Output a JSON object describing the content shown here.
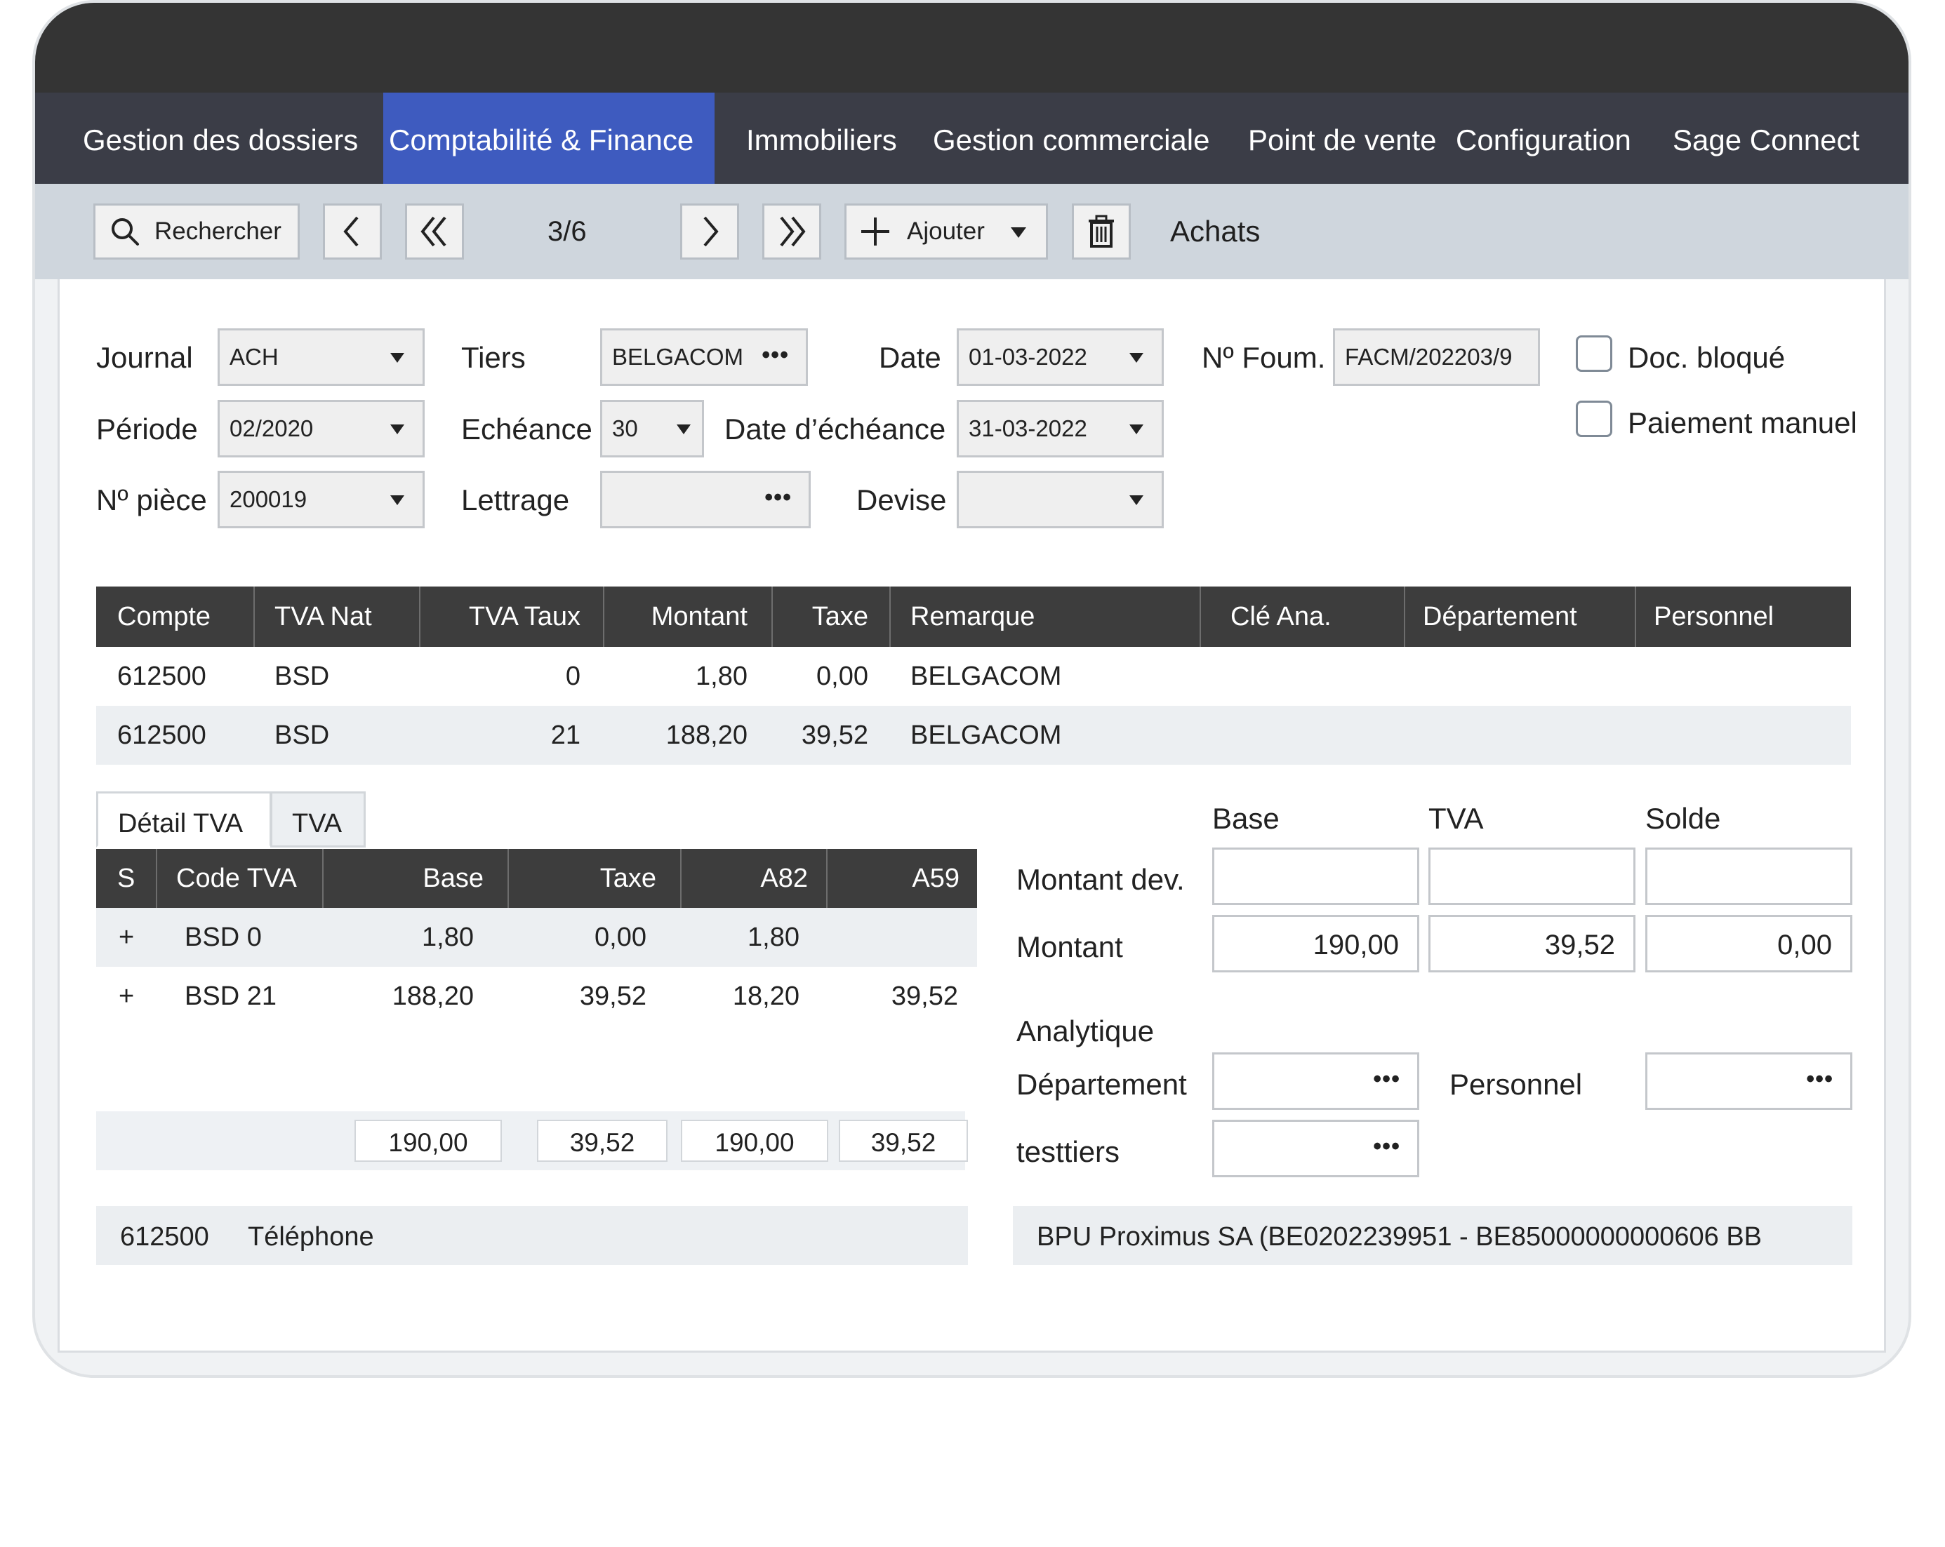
{
  "menu": {
    "items": [
      {
        "label": "Gestion des dossiers"
      },
      {
        "label": "Comptabilité & Finance",
        "active": true
      },
      {
        "label": "Immobiliers"
      },
      {
        "label": "Gestion commerciale"
      },
      {
        "label": "Point de vente"
      },
      {
        "label": "Configuration"
      },
      {
        "label": "Sage Connect"
      }
    ]
  },
  "toolbar": {
    "search_label": "Rechercher",
    "pager": "3/6",
    "add_label": "Ajouter",
    "section": "Achats",
    "icons": [
      "search-icon",
      "chevron-left-icon",
      "double-chevron-left-icon",
      "chevron-right-icon",
      "double-chevron-right-icon",
      "plus-icon",
      "caret-down-icon",
      "trash-icon"
    ]
  },
  "form": {
    "journal": {
      "label": "Journal",
      "value": "ACH"
    },
    "periode": {
      "label": "Période",
      "value": "02/2020"
    },
    "piece": {
      "label": "Nº pièce",
      "value": "200019"
    },
    "tiers": {
      "label": "Tiers",
      "value": "BELGACOM"
    },
    "echeance": {
      "label": "Echéance",
      "value": "30"
    },
    "lettrage": {
      "label": "Lettrage",
      "value": ""
    },
    "date": {
      "label": "Date",
      "value": "01-03-2022"
    },
    "date_echeance": {
      "label": "Date d’échéance",
      "value": "31-03-2022"
    },
    "devise": {
      "label": "Devise",
      "value": ""
    },
    "num_fourn": {
      "label": "Nº Foum.",
      "value": "FACM/202203/9"
    },
    "doc_bloque": {
      "label": "Doc. bloqué",
      "checked": false
    },
    "paiement_manuel": {
      "label": "Paiement manuel",
      "checked": false
    }
  },
  "lines": {
    "columns": [
      "Compte",
      "TVA Nat",
      "TVA Taux",
      "Montant",
      "Taxe",
      "Remarque",
      "Clé Ana.",
      "Département",
      "Personnel"
    ],
    "rows": [
      [
        "612500",
        "BSD",
        "0",
        "1,80",
        "0,00",
        "BELGACOM",
        "",
        "",
        ""
      ],
      [
        "612500",
        "BSD",
        "21",
        "188,20",
        "39,52",
        "BELGACOM",
        "",
        "",
        ""
      ]
    ]
  },
  "vat": {
    "tabs": [
      "Détail TVA",
      "TVA"
    ],
    "columns": [
      "S",
      "Code TVA",
      "Base",
      "Taxe",
      "A82",
      "A59"
    ],
    "rows": [
      [
        "+",
        "BSD 0",
        "1,80",
        "0,00",
        "1,80",
        ""
      ],
      [
        "+",
        "BSD 21",
        "188,20",
        "39,52",
        "18,20",
        "39,52"
      ]
    ],
    "totals": [
      "190,00",
      "39,52",
      "190,00",
      "39,52"
    ]
  },
  "summary": {
    "headers": [
      "Base",
      "TVA",
      "Solde"
    ],
    "montant_dev": {
      "label": "Montant dev.",
      "values": [
        "",
        "",
        ""
      ]
    },
    "montant": {
      "label": "Montant",
      "values": [
        "190,00",
        "39,52",
        "0,00"
      ]
    },
    "analytique_label": "Analytique",
    "departement_label": "Département",
    "personnel_label": "Personnel",
    "testtiers_label": "testtiers"
  },
  "footer": {
    "account": "612500",
    "account_name": "Téléphone",
    "supplier_info": "BPU Proximus SA (BE0202239951 - BE85000000000606 BB"
  },
  "colors": {
    "accent": "#3e5bbf",
    "menubar": "#3b3d47",
    "titlebar": "#343434",
    "toolbar": "#cfd6dd",
    "grid_header": "#3d3d3d"
  }
}
